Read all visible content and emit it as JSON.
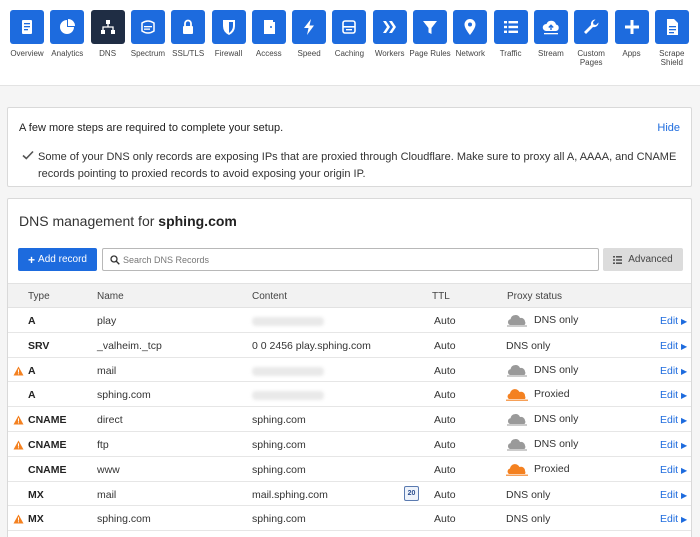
{
  "nav": [
    {
      "label": "Overview",
      "icon": "overview-icon"
    },
    {
      "label": "Analytics",
      "icon": "analytics-icon"
    },
    {
      "label": "DNS",
      "icon": "dns-icon"
    },
    {
      "label": "Spectrum",
      "icon": "spectrum-icon"
    },
    {
      "label": "SSL/TLS",
      "icon": "lock-icon"
    },
    {
      "label": "Firewall",
      "icon": "shield-icon"
    },
    {
      "label": "Access",
      "icon": "door-icon"
    },
    {
      "label": "Speed",
      "icon": "bolt-icon"
    },
    {
      "label": "Caching",
      "icon": "caching-icon"
    },
    {
      "label": "Workers",
      "icon": "workers-icon"
    },
    {
      "label": "Page Rules",
      "icon": "filter-icon"
    },
    {
      "label": "Network",
      "icon": "location-pin-icon"
    },
    {
      "label": "Traffic",
      "icon": "list-icon"
    },
    {
      "label": "Stream",
      "icon": "cloud-upload-icon"
    },
    {
      "label": "Custom Pages",
      "icon": "wrench-icon"
    },
    {
      "label": "Apps",
      "icon": "plus-icon"
    },
    {
      "label": "Scrape Shield",
      "icon": "document-icon"
    }
  ],
  "active_nav": "DNS",
  "setup": {
    "title": "A few more steps are required to complete your setup.",
    "hide_label": "Hide",
    "message": "Some of your DNS only records are exposing IPs that are proxied through Cloudflare. Make sure to proxy all A, AAAA, and CNAME records pointing to proxied records to avoid exposing your origin IP."
  },
  "dns": {
    "title_prefix": "DNS management for",
    "domain": "sphing.com",
    "add_record_label": "Add record",
    "search_placeholder": "Search DNS Records",
    "advanced_label": "Advanced",
    "columns": {
      "type": "Type",
      "name": "Name",
      "content": "Content",
      "ttl": "TTL",
      "proxy": "Proxy status"
    },
    "edit_label": "Edit",
    "records": [
      {
        "warn": false,
        "type": "A",
        "name": "play",
        "content": "",
        "content_hidden": true,
        "badge": "",
        "ttl": "Auto",
        "proxy": "DNS only",
        "cloud": "grey"
      },
      {
        "warn": false,
        "type": "SRV",
        "name": "_valheim._tcp",
        "content": "0 0 2456 play.sphing.com",
        "content_hidden": false,
        "badge": "",
        "ttl": "Auto",
        "proxy": "DNS only",
        "cloud": "none"
      },
      {
        "warn": true,
        "type": "A",
        "name": "mail",
        "content": "",
        "content_hidden": true,
        "badge": "",
        "ttl": "Auto",
        "proxy": "DNS only",
        "cloud": "grey"
      },
      {
        "warn": false,
        "type": "A",
        "name": "sphing.com",
        "content": "",
        "content_hidden": true,
        "badge": "",
        "ttl": "Auto",
        "proxy": "Proxied",
        "cloud": "orange"
      },
      {
        "warn": true,
        "type": "CNAME",
        "name": "direct",
        "content": "sphing.com",
        "content_hidden": false,
        "badge": "",
        "ttl": "Auto",
        "proxy": "DNS only",
        "cloud": "grey"
      },
      {
        "warn": true,
        "type": "CNAME",
        "name": "ftp",
        "content": "sphing.com",
        "content_hidden": false,
        "badge": "",
        "ttl": "Auto",
        "proxy": "DNS only",
        "cloud": "grey"
      },
      {
        "warn": false,
        "type": "CNAME",
        "name": "www",
        "content": "sphing.com",
        "content_hidden": false,
        "badge": "",
        "ttl": "Auto",
        "proxy": "Proxied",
        "cloud": "orange"
      },
      {
        "warn": false,
        "type": "MX",
        "name": "mail",
        "content": "mail.sphing.com",
        "content_hidden": false,
        "badge": "20",
        "ttl": "Auto",
        "proxy": "DNS only",
        "cloud": "none"
      },
      {
        "warn": true,
        "type": "MX",
        "name": "sphing.com",
        "content": "sphing.com",
        "content_hidden": false,
        "badge": "",
        "ttl": "Auto",
        "proxy": "DNS only",
        "cloud": "none"
      }
    ]
  },
  "colors": {
    "accent": "#1d6bde",
    "active_nav": "#1f2d44",
    "warning": "#f48120",
    "proxied_cloud": "#f48120",
    "dns_only_cloud": "#9a9a9a"
  }
}
